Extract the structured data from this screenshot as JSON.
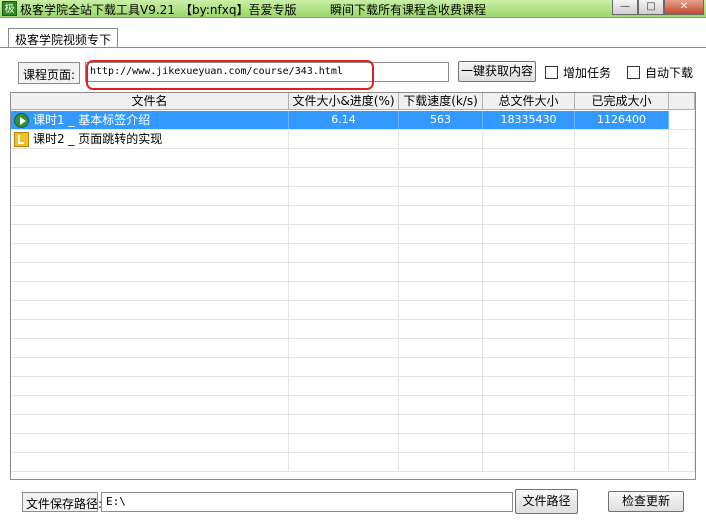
{
  "window": {
    "icon_glyph": "极",
    "title": "极客学院全站下载工具V9.21",
    "author": "【by:nfxq】吾爱专版",
    "slogan": "瞬间下载所有课程含收费课程",
    "minimize_glyph": "—",
    "maximize_glyph": "□",
    "close_glyph": "✕",
    "icons": [
      "app-icon",
      "minimize-icon",
      "maximize-icon",
      "close-icon"
    ]
  },
  "tabs": [
    {
      "label": "极客学院视频专下"
    }
  ],
  "course": {
    "label": "课程页面:",
    "url": "http://www.jikexueyuan.com/course/343.html",
    "fetch_button": "一键获取内容",
    "add_task_label": "增加任务",
    "add_task_checked": false,
    "auto_download_label": "自动下载",
    "auto_download_checked": false,
    "highlight_color": "#e02020"
  },
  "table": {
    "columns": [
      "文件名",
      "文件大小&进度(%)",
      "下载速度(k/s)",
      "总文件大小",
      "已完成大小"
    ],
    "rows": [
      {
        "name": "课时1 _ 基本标签介绍",
        "progress": "6.14",
        "speed": "563",
        "total": "18335430",
        "done": "1126400",
        "status_icon": "play-icon",
        "selected": true
      },
      {
        "name": "课时2 _ 页面跳转的实现",
        "progress": "",
        "speed": "",
        "total": "",
        "done": "",
        "status_icon": "waiting-icon",
        "selected": false
      }
    ],
    "selection_color": "#3399ff"
  },
  "footer": {
    "path_label": "文件保存路径:",
    "path_value": "E:\\",
    "path_button": "文件路径",
    "update_button": "检查更新"
  }
}
